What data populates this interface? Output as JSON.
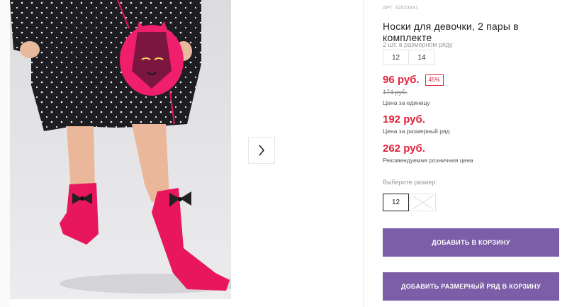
{
  "gallery": {
    "next_icon": "chevron-right-icon",
    "photo_subject": "socks-photo"
  },
  "product": {
    "article": "АРТ. 32023441",
    "title": "Носки для девочки, 2 пары в комплекте",
    "pack_note": "2 шт. в размерном ряду",
    "pack_sizes": [
      "12",
      "14"
    ],
    "price": "96 руб.",
    "discount": "45%",
    "old_price": "174 руб.",
    "unit_caption": "Цена за единицу",
    "row_price": "192 руб.",
    "row_caption": "Цена за размерный ряд",
    "retail_price": "262 руб.",
    "retail_caption": "Рекомендуемая розничная цена"
  },
  "size_select": {
    "label": "Выберите размер:",
    "options": [
      {
        "value": "12",
        "state": "selected"
      },
      {
        "value": "",
        "state": "unavailable"
      }
    ]
  },
  "actions": {
    "add_to_cart": "ДОБАВИТЬ В КОРЗИНУ",
    "add_row_to_cart": "ДОБАВИТЬ РАЗМЕРНЫЙ РЯД В КОРЗИНУ"
  },
  "colors": {
    "accent_red": "#e0233d",
    "button_purple": "#7b5ea7",
    "sock_pink": "#e8175d"
  }
}
